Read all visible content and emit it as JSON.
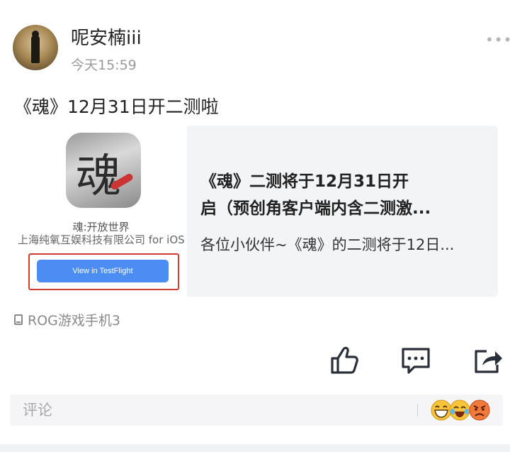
{
  "post": {
    "username": "呢安楠iii",
    "time": "今天15:59",
    "more_label": "•••",
    "text": "《魂》12月31日开二测啦"
  },
  "card": {
    "app_icon_glyph": "魂",
    "app_name": "魂:开放世界",
    "app_company": "上海纯氧互娱科技有限公司 for iOS",
    "button_label": "View in TestFlight",
    "title_line1": "《魂》二测将于12月31日开",
    "title_line2": "启（预创角客户端内含二测激...",
    "description": "各位小伙伴~《魂》的二测将于12日..."
  },
  "device": {
    "label": "ROG游戏手机3",
    "icon": "phone-icon"
  },
  "actions": {
    "like_icon": "thumbs-up-icon",
    "comment_icon": "comment-icon",
    "share_icon": "share-icon"
  },
  "comment": {
    "placeholder": "评论",
    "emojis": [
      "grinning-face-emoji",
      "tears-of-joy-emoji",
      "angry-face-emoji"
    ]
  },
  "colors": {
    "button_blue": "#4b8df3",
    "highlight_red": "#d23c32",
    "card_bg": "#f3f4f6"
  }
}
